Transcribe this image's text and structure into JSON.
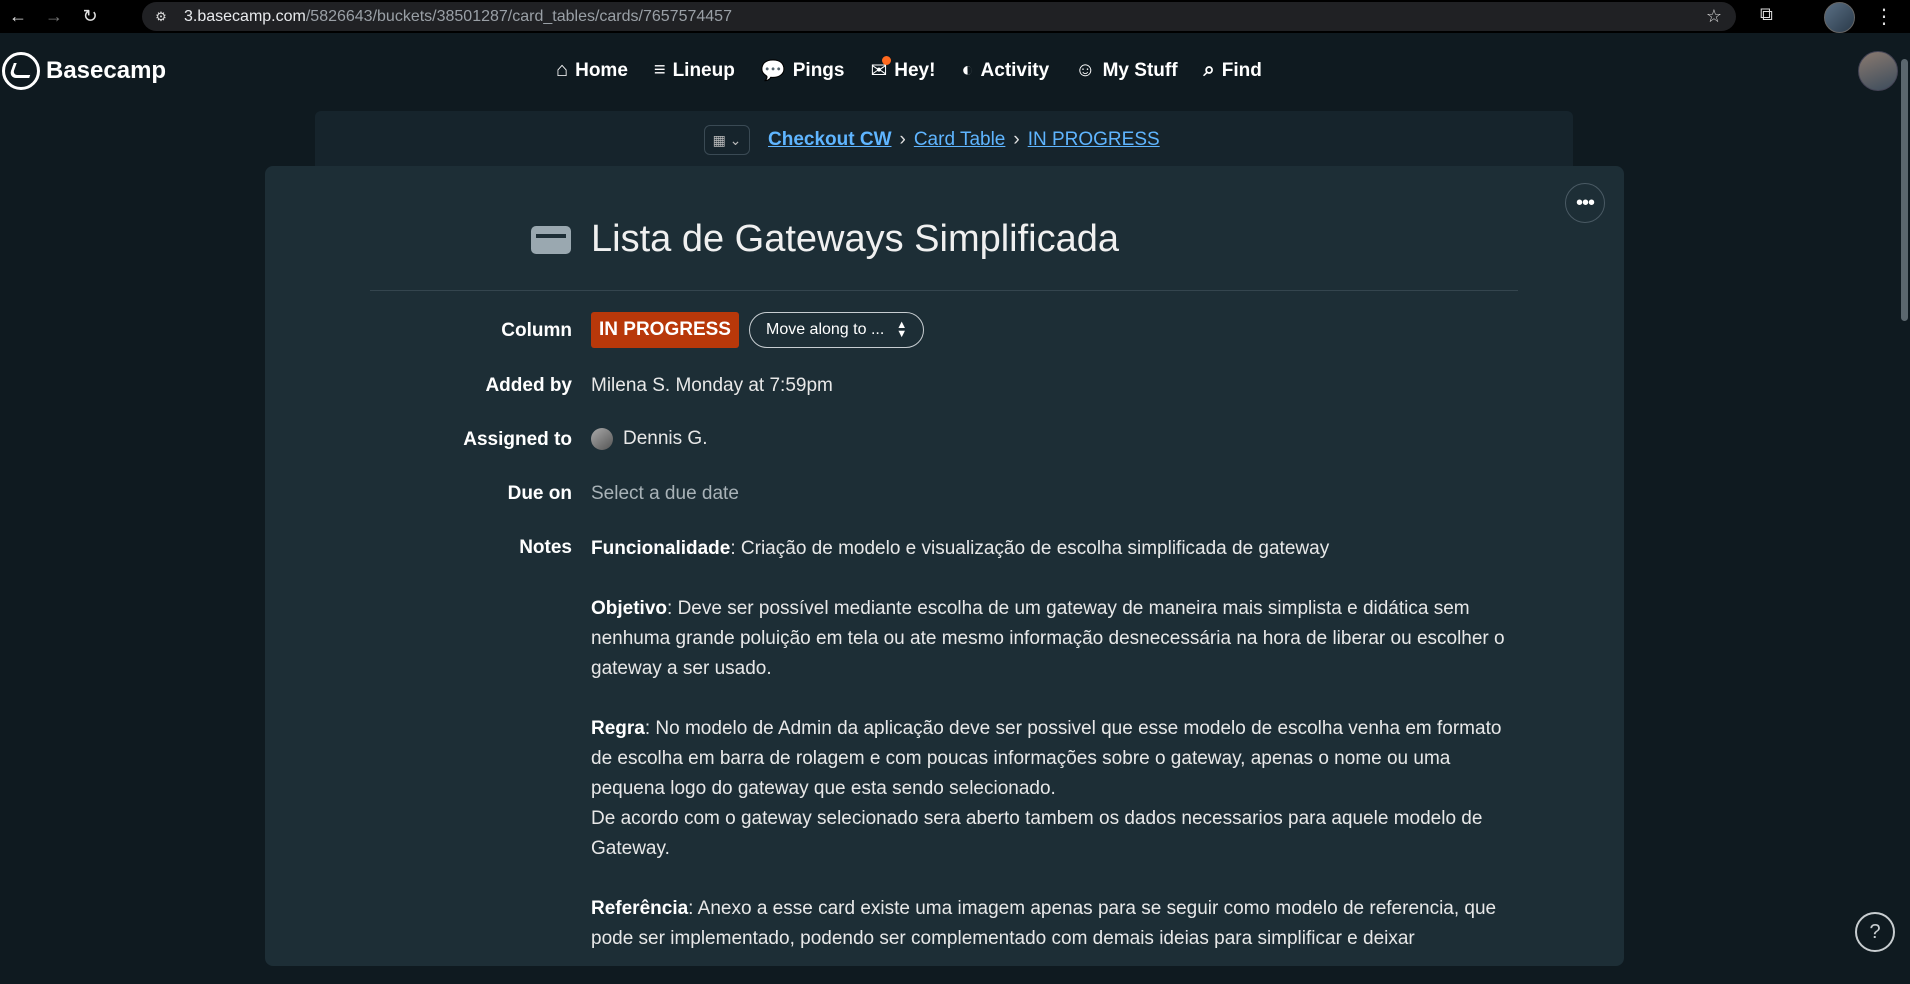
{
  "browser": {
    "url_host": "3.basecamp.com",
    "url_path": "/5826643/buckets/38501287/card_tables/cards/7657574457"
  },
  "app": {
    "logo_text": "Basecamp",
    "nav": [
      {
        "label": "Home",
        "icon": "home-icon"
      },
      {
        "label": "Lineup",
        "icon": "lineup-icon"
      },
      {
        "label": "Pings",
        "icon": "pings-icon"
      },
      {
        "label": "Hey!",
        "icon": "hey-icon"
      },
      {
        "label": "Activity",
        "icon": "activity-icon"
      },
      {
        "label": "My Stuff",
        "icon": "my-stuff-icon"
      },
      {
        "label": "Find",
        "icon": "search-icon"
      }
    ]
  },
  "breadcrumb": {
    "project": "Checkout CW",
    "table": "Card Table",
    "column": "IN PROGRESS",
    "separator": "›"
  },
  "card": {
    "title": "Lista de Gateways Simplificada",
    "fields": {
      "column_label": "Column",
      "column_value": "IN PROGRESS",
      "column_color": "#b8380a",
      "move_label": "Move along to ...",
      "added_by_label": "Added by",
      "added_by_value": "Milena S. Monday at 7:59pm",
      "assigned_label": "Assigned to",
      "assigned_value": "Dennis G.",
      "due_label": "Due on",
      "due_placeholder": "Select a due date",
      "notes_label": "Notes"
    },
    "notes": {
      "p1_bold": "Funcionalidade",
      "p1_text": ": Criação de modelo e visualização de escolha simplificada de gateway",
      "p2_bold": "Objetivo",
      "p2_text": ": Deve ser possível mediante escolha de um gateway de maneira mais simplista e didática sem nenhuma grande poluição em tela ou ate mesmo informação desnecessária na hora de liberar ou escolher o gateway a ser usado.",
      "p3_bold": "Regra",
      "p3_text": ": No modelo de Admin da aplicação deve ser possivel que esse modelo de escolha venha em formato de escolha em barra de rolagem e com poucas informações sobre o gateway, apenas o nome ou uma pequena logo do gateway que esta sendo selecionado.",
      "p3_text2": "De acordo com o gateway selecionado sera aberto tambem os dados necessarios para aquele modelo de Gateway.",
      "p4_bold": "Referência",
      "p4_text": ": Anexo a esse card existe uma imagem apenas para se seguir como modelo de referencia, que pode ser implementado, podendo ser complementado com demais ideias para simplificar e deixar"
    }
  },
  "help_label": "?"
}
